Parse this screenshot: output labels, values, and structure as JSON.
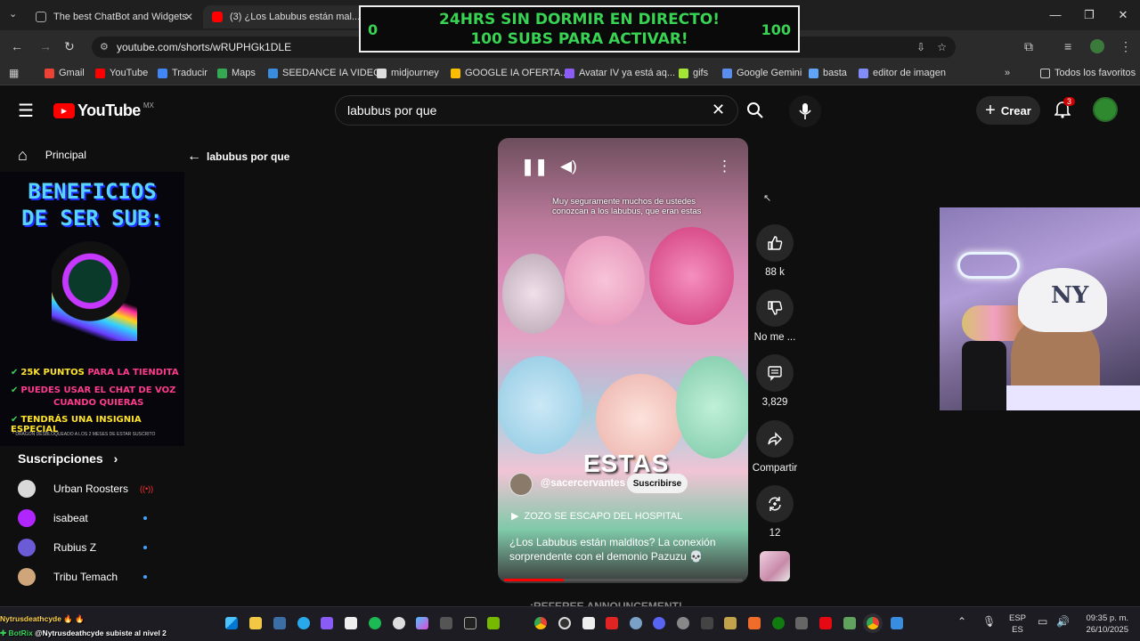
{
  "tabs": [
    {
      "title": "The best ChatBot and Widgets",
      "close": "✕"
    },
    {
      "title": "(3) ¿Los Labubus están mal...",
      "close": "✕"
    }
  ],
  "new_tab": "+",
  "overlay": {
    "line1": "24HRS SIN DORMIR EN DIRECTO!",
    "line2": "100 SUBS PARA ACTIVAR!",
    "left_count": "0",
    "right_count": "100"
  },
  "address": {
    "url": "youtube.com/shorts/wRUPHGk1DLE"
  },
  "bookmarks": [
    {
      "label": "Gmail",
      "color": "#ea4335"
    },
    {
      "label": "YouTube",
      "color": "#ff0000"
    },
    {
      "label": "Traducir",
      "color": "#4285f4"
    },
    {
      "label": "Maps",
      "color": "#34a853"
    },
    {
      "label": "SEEDANCE IA VIDEO",
      "color": "#3a8dde"
    },
    {
      "label": "midjourney",
      "color": "#dddddd"
    },
    {
      "label": "GOOGLE IA OFERTA...",
      "color": "#fbbc04"
    },
    {
      "label": "Avatar IV ya está aq...",
      "color": "#8b5cf6"
    },
    {
      "label": "gifs",
      "color": "#a3e635"
    },
    {
      "label": "Google Gemini",
      "color": "#5b8def"
    },
    {
      "label": "basta",
      "color": "#60a5fa"
    },
    {
      "label": "editor de imagen",
      "color": "#818cf8"
    }
  ],
  "all_bookmarks": "Todos los favoritos",
  "yt": {
    "logo": "YouTube",
    "region": "MX",
    "search_value": "labubus por que",
    "create": "Crear",
    "notif_count": "3",
    "back_query": "labubus por que"
  },
  "sidebar": {
    "home": "Principal",
    "subs_header": "Suscripciones",
    "subs": [
      {
        "name": "Urban Roosters",
        "color": "#d9d9d9",
        "live": true
      },
      {
        "name": "isabeat",
        "color": "#b026ff",
        "live": false
      },
      {
        "name": "Rubius Z",
        "color": "#6b5bd6",
        "live": false
      },
      {
        "name": "Tribu Temach",
        "color": "#cfa57a",
        "live": false
      }
    ]
  },
  "promo": {
    "title1": "BENEFICIOS",
    "title2": "DE SER SUB:",
    "b1a": "25K PUNTOS",
    "b1b": "PARA LA TIENDITA",
    "b2": "PUEDES USAR EL CHAT DE VOZ",
    "b2b": "CUANDO QUIERAS",
    "b3": "TENDRÁS UNA INSIGNIA ESPECIAL",
    "footer": "* DRAGÓN DESBLOQUEADO A LOS 2 MESES DE ESTAR SUSCRITO"
  },
  "short": {
    "caption_l1": "Muy seguramente muchos de ustedes",
    "caption_l2": "conozcan a los labubus, que eran estas",
    "overlay_word": "ESTAS",
    "channel": "@sacercervantes",
    "subscribe": "Suscribirse",
    "song": "ZOZO SE ESCAPO DEL HOSPITAL",
    "title": "¿Los Labubus están malditos? La conexión sorprendente con el demonio Pazuzu 💀",
    "progress": 0.25
  },
  "actions": {
    "likes": "88 k",
    "dislike": "No me ...",
    "comments": "3,829",
    "share": "Compartir",
    "remix": "12"
  },
  "below_text": "¡REFEREE ANNOUNCEMENT!",
  "chat": {
    "line1_user": "Nytrusdeathcyde",
    "line2_user": "BotRix",
    "line2_text": "@Nytrusdeathcyde subiste al nivel 2"
  },
  "taskbar": {
    "lang1": "ESP",
    "lang2": "ES",
    "time": "09:35 p. m.",
    "date": "26/10/2025"
  }
}
